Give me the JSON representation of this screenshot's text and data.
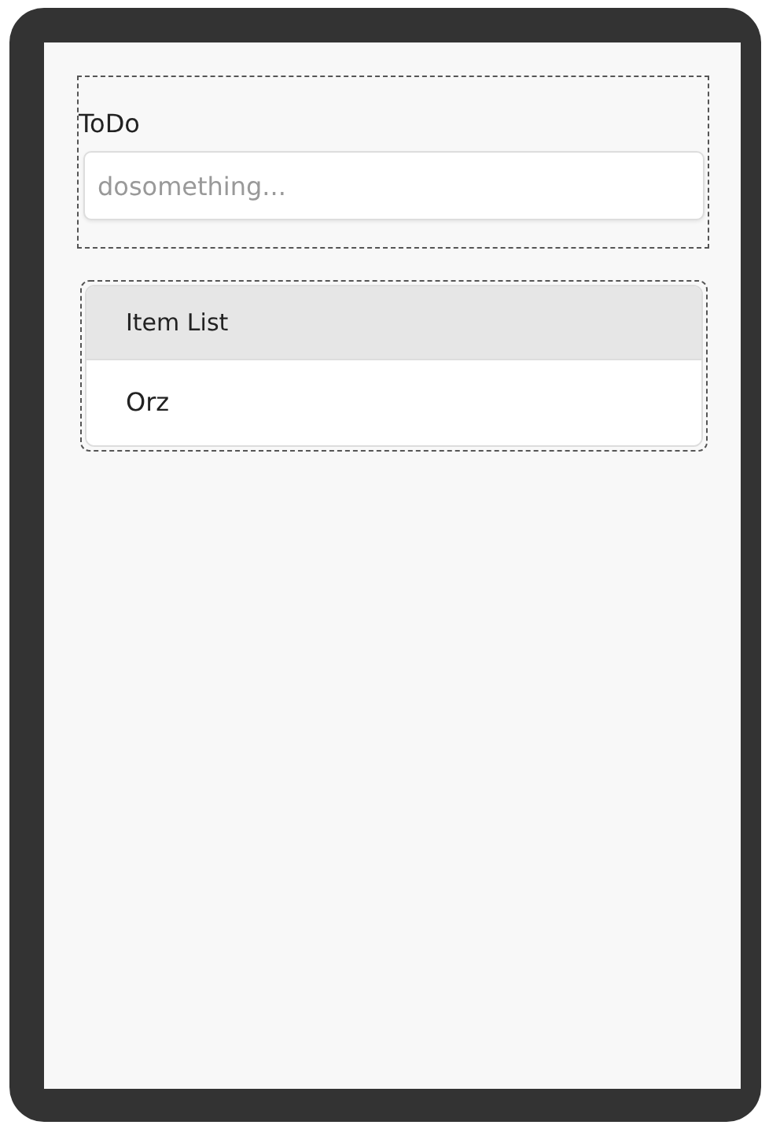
{
  "form": {
    "label": "ToDo",
    "input": {
      "placeholder": "dosomething..."
    }
  },
  "item_list": {
    "header": "Item List",
    "items": [
      {
        "text": "Orz"
      }
    ]
  }
}
